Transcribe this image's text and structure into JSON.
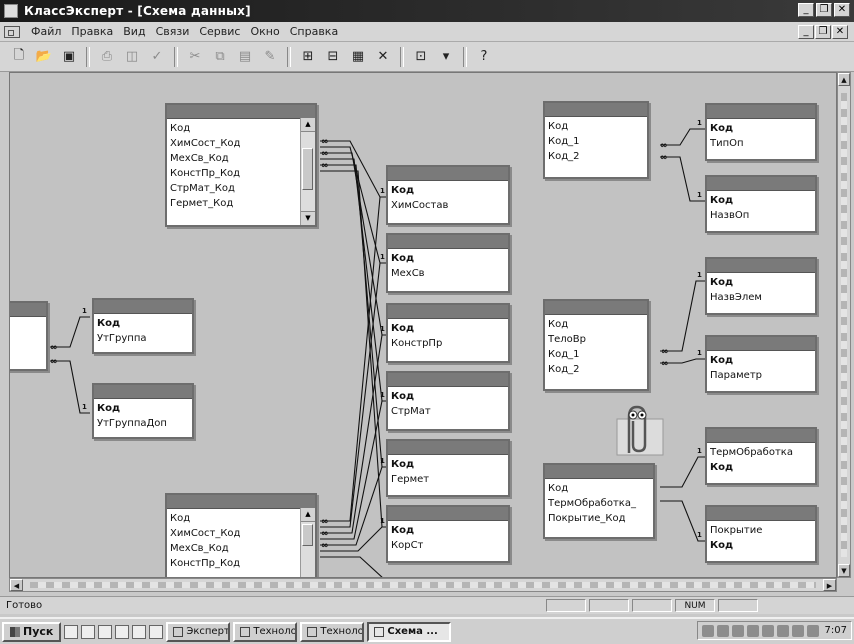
{
  "window": {
    "title": "КлассЭксперт - [Схема данных]"
  },
  "menu": {
    "items": [
      "Файл",
      "Правка",
      "Вид",
      "Связи",
      "Сервис",
      "Окно",
      "Справка"
    ]
  },
  "toolbar": {
    "buttons": [
      "new-icon",
      "open-icon",
      "save-icon",
      "print-icon",
      "preview-icon",
      "spell-icon",
      "cut-icon",
      "copy-icon",
      "paste-icon",
      "format-painter-icon",
      "show-table-icon",
      "show-direct-icon",
      "show-all-icon",
      "delete-icon",
      "new-object-icon",
      "help-icon"
    ]
  },
  "tables": {
    "t1": {
      "fields": [
        "Код",
        "ХимСост_Код",
        "МехСв_Код",
        "КонстПр_Код",
        "СтрМат_Код",
        "Гермет_Код"
      ]
    },
    "t2": {
      "fields": [
        "Код",
        "УтГруппа"
      ]
    },
    "t3": {
      "fields": [
        "Код",
        "УтГруппаДоп"
      ]
    },
    "t4": {
      "fields": [
        "Код",
        "ХимСост_Код",
        "МехСв_Код",
        "КонстПр_Код"
      ]
    },
    "t5": {
      "fields": [
        "Код",
        "ХимСостав"
      ]
    },
    "t6": {
      "fields": [
        "Код",
        "МехСв"
      ]
    },
    "t7": {
      "fields": [
        "Код",
        "КонстрПр"
      ]
    },
    "t8": {
      "fields": [
        "Код",
        "СтрМат"
      ]
    },
    "t9": {
      "fields": [
        "Код",
        "Гермет"
      ]
    },
    "t10": {
      "fields": [
        "Код",
        "КорСт"
      ]
    },
    "t11": {
      "fields": [
        "Код",
        "Код_1",
        "Код_2"
      ]
    },
    "t12": {
      "fields": [
        "Код",
        "ТипОп"
      ]
    },
    "t13": {
      "fields": [
        "Код",
        "НазвОп"
      ]
    },
    "t14": {
      "fields": [
        "Код",
        "ТелоВр",
        "Код_1",
        "Код_2"
      ]
    },
    "t15": {
      "fields": [
        "Код",
        "НазвЭлем"
      ]
    },
    "t16": {
      "fields": [
        "Код",
        "Параметр"
      ]
    },
    "t17": {
      "fields": [
        "Код",
        "ТермОбработка_",
        "Покрытие_Код"
      ]
    },
    "t18": {
      "fields": [
        "ТермОбработка",
        "Код"
      ]
    },
    "t19": {
      "fields": [
        "Покрытие",
        "Код"
      ]
    }
  },
  "relationship_labels": {
    "one": "1",
    "many": "∞"
  },
  "status": {
    "text": "Готово",
    "num": "NUM"
  },
  "taskbar": {
    "start": "Пуск",
    "tasks": [
      "Эксперт...",
      "Техноло...",
      "Техноло...",
      "Схема ..."
    ],
    "clock": "7:07"
  }
}
